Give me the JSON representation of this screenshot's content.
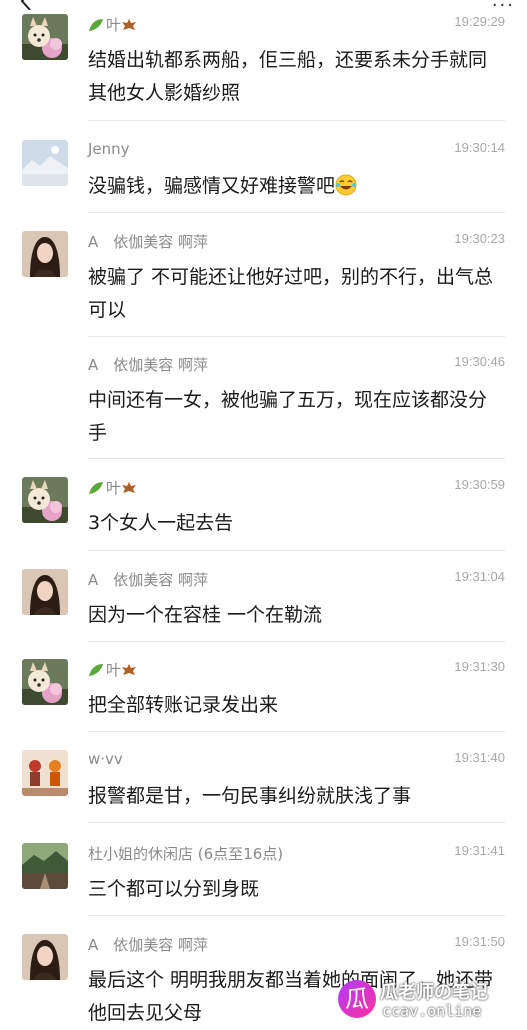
{
  "messages": [
    {
      "name": "叶",
      "name_icons": [
        "leaf-icon",
        "maple-leaf-icon"
      ],
      "time": "19:29:29",
      "avatar": "dog-avatar",
      "text": "结婚出轨都系两船，佢三船，还要系未分手就同其他女人影婚纱照"
    },
    {
      "name": "Jenny",
      "time": "19:30:14",
      "avatar": "landscape-avatar",
      "text": "没骗钱，骗感情又好难接警吧",
      "emoji": "laughing-tears-emoji"
    },
    {
      "name": "A　依伽美容 啊萍",
      "time": "19:30:23",
      "avatar": "woman-avatar",
      "text": "被骗了 不可能还让他好过吧，别的不行，出气总可以"
    },
    {
      "name": "A　依伽美容 啊萍",
      "time": "19:30:46",
      "text": "中间还有一女，被他骗了五万，现在应该都没分手"
    },
    {
      "name": "叶",
      "name_icons": [
        "leaf-icon",
        "maple-leaf-icon"
      ],
      "time": "19:30:59",
      "avatar": "dog-avatar",
      "text": "3个女人一起去告"
    },
    {
      "name": "A　依伽美容 啊萍",
      "time": "19:31:04",
      "avatar": "woman-avatar",
      "text": "因为一个在容桂 一个在勒流"
    },
    {
      "name": "叶",
      "name_icons": [
        "leaf-icon",
        "maple-leaf-icon"
      ],
      "time": "19:31:30",
      "avatar": "dog-avatar",
      "text": "把全部转账记录发出来"
    },
    {
      "name": "w·vv",
      "time": "19:31:40",
      "avatar": "cartoon-avatar",
      "text": "报警都是甘，一句民事纠纷就肤浅了事"
    },
    {
      "name": "杜小姐的休闲店 (6点至16点)",
      "time": "19:31:41",
      "avatar": "scenery-avatar",
      "text": "三个都可以分到身既"
    },
    {
      "name": "A　依伽美容 啊萍",
      "time": "19:31:50",
      "avatar": "woman-avatar",
      "text": "最后这个 明明我朋友都当着她的面闹了，她还带他回去见父母"
    }
  ],
  "watermark": {
    "logo": "瓜",
    "title": "瓜老师の笔记",
    "subtitle": "ccav.online"
  },
  "colors": {
    "name": "#8a8a8a",
    "time": "#a8a8a8",
    "text": "#1b1b1b",
    "separator": "#e6e6e6"
  }
}
